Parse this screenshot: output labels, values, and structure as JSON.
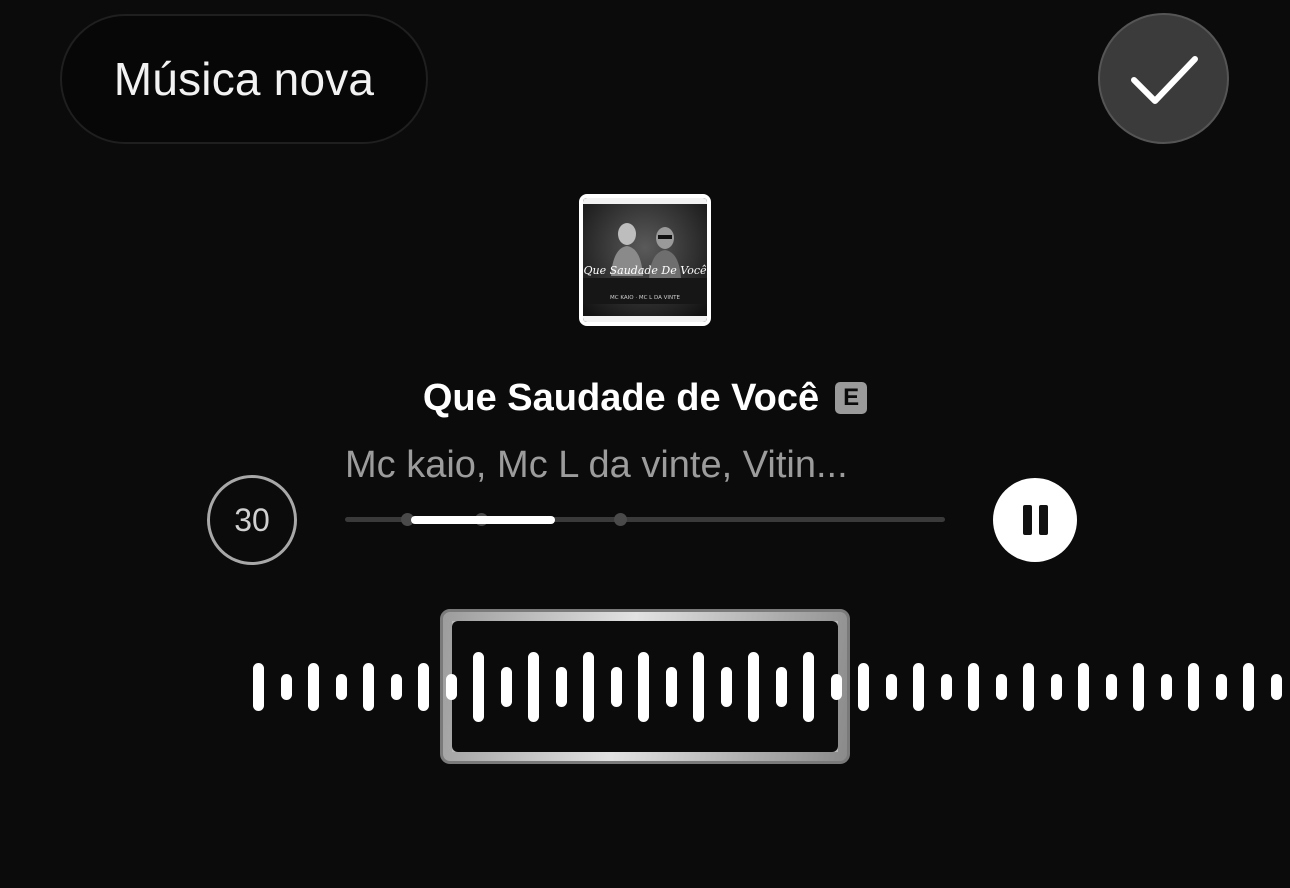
{
  "header": {
    "new_music_label": "Música nova",
    "confirm_icon": "checkmark-icon"
  },
  "track": {
    "album_art_text": "Que Saudade De Você",
    "album_art_credit": "MC KAIO · MC L DA VINTE",
    "title": "Que Saudade de Você",
    "explicit_badge": "E",
    "artists": "Mc kaio, Mc L da vinte, Vitin..."
  },
  "player": {
    "clip_duration": "30",
    "progress_fraction": 0.24,
    "pause_icon": "pause-icon"
  },
  "waveform": {
    "selection_icon": "clip-selection-window"
  }
}
